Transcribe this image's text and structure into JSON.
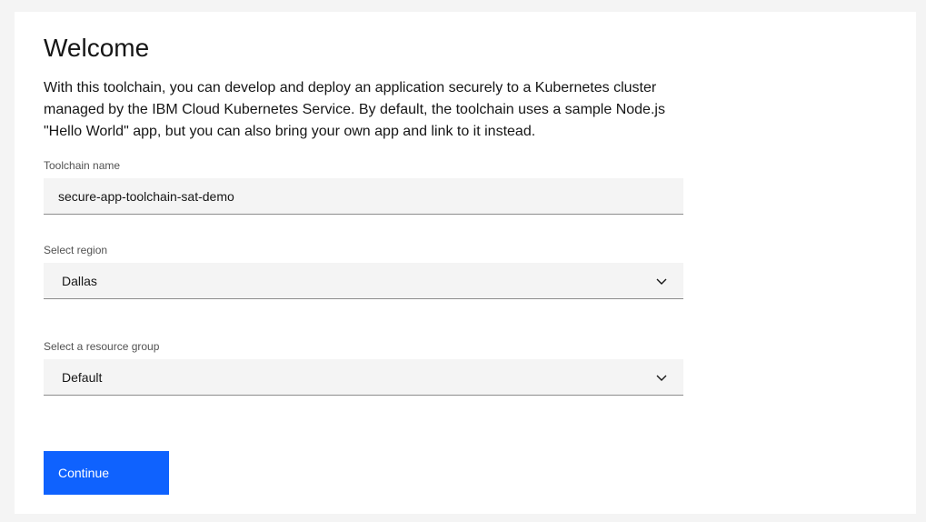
{
  "welcome": {
    "title": "Welcome",
    "description": "With this toolchain, you can develop and deploy an application securely to a Kubernetes cluster managed by the IBM Cloud Kubernetes Service. By default, the toolchain uses a sample Node.js \"Hello World\" app, but you can also bring your own app and link to it instead."
  },
  "form": {
    "toolchain_name": {
      "label": "Toolchain name",
      "value": "secure-app-toolchain-sat-demo"
    },
    "region": {
      "label": "Select region",
      "selected": "Dallas",
      "icon": "chevron-down-icon"
    },
    "resource_group": {
      "label": "Select a resource group",
      "selected": "Default",
      "icon": "chevron-down-icon"
    },
    "continue_label": "Continue"
  },
  "colors": {
    "page_background": "#f4f4f4",
    "card_background": "#ffffff",
    "field_background": "#f4f4f4",
    "field_border": "#8d8d8d",
    "primary_button": "#0f62fe",
    "text_primary": "#161616",
    "text_secondary": "#525252"
  }
}
